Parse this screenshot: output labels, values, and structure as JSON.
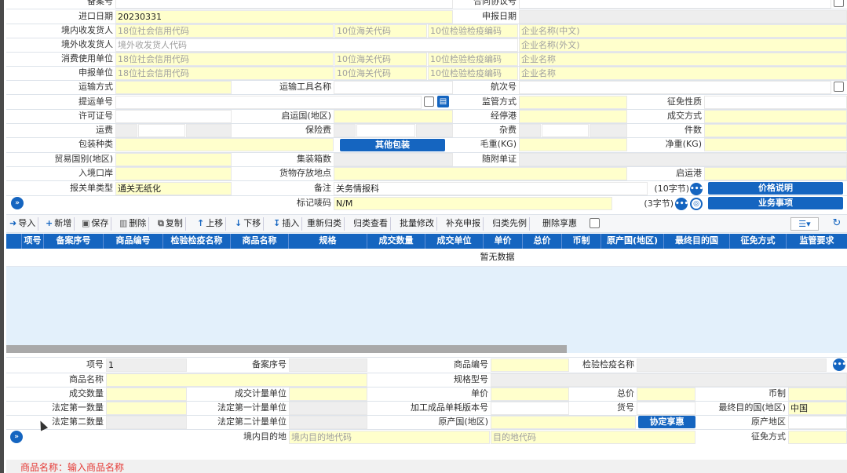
{
  "form": {
    "record_no_label": "备案号",
    "contract_no_label": "合同协议号",
    "import_date_label": "进口日期",
    "import_date": "20230331",
    "declare_date_label": "申报日期",
    "domestic_consignee_label": "境内收发货人",
    "credit_code_ph": "18位社会信用代码",
    "customs_code_ph": "10位海关代码",
    "ciq_code_ph": "10位检验检疫编码",
    "company_cn_ph": "企业名称(中文)",
    "overseas_consignee_label": "境外收发货人",
    "overseas_code_ph": "境外收发货人代码",
    "company_foreign_ph": "企业名称(外文)",
    "consumer_unit_label": "消费使用单位",
    "company_name_ph": "企业名称",
    "declarant_label": "申报单位",
    "transport_mode_label": "运输方式",
    "transport_tool_label": "运输工具名称",
    "voyage_label": "航次号",
    "bill_no_label": "提运单号",
    "supervision_label": "监管方式",
    "exemption_nature_label": "征免性质",
    "license_label": "许可证号",
    "departure_country_label": "启运国(地区)",
    "transit_port_label": "经停港",
    "deal_mode_label": "成交方式",
    "freight_label": "运费",
    "insurance_label": "保险费",
    "misc_fee_label": "杂费",
    "pieces_label": "件数",
    "package_label": "包装种类",
    "other_package_btn": "其他包装",
    "gross_weight_label": "毛重(KG)",
    "net_weight_label": "净重(KG)",
    "trade_country_label": "贸易国别(地区)",
    "container_count_label": "集装箱数",
    "attached_docs_label": "随附单证",
    "entry_port_label": "入境口岸",
    "goods_location_label": "货物存放地点",
    "departure_port_label": "启运港",
    "declaration_type_label": "报关单类型",
    "declaration_type": "通关无纸化",
    "remark_label": "备注",
    "remark": "关务情报科",
    "remark_hint": "(10字节)",
    "price_note_btn": "价格说明",
    "mark_label": "标记唛码",
    "mark": "N/M",
    "mark_hint": "(3字节)",
    "business_btn": "业务事项"
  },
  "toolbar": [
    "导入",
    "新增",
    "保存",
    "删除",
    "复制",
    "上移",
    "下移",
    "插入",
    "重新归类",
    "归类查看",
    "批量修改",
    "补充申报",
    "归类先例",
    "删除享惠"
  ],
  "table": {
    "headers": [
      "项号",
      "备案序号",
      "商品编号",
      "检验检疫名称",
      "商品名称",
      "规格",
      "成交数量",
      "成交单位",
      "单价",
      "总价",
      "币制",
      "原产国(地区)",
      "最终目的国",
      "征免方式",
      "监管要求"
    ],
    "empty": "暂无数据"
  },
  "detail": {
    "item_no_label": "项号",
    "item_no": "1",
    "record_seq_label": "备案序号",
    "goods_code_label": "商品编号",
    "ciq_name_label": "检验检疫名称",
    "goods_name_label": "商品名称",
    "spec_label": "规格型号",
    "deal_qty_label": "成交数量",
    "deal_unit_label": "成交计量单位",
    "unit_price_label": "单价",
    "total_price_label": "总价",
    "currency_label": "币制",
    "legal_qty1_label": "法定第一数量",
    "legal_unit1_label": "法定第一计量单位",
    "bom_version_label": "加工成品单耗版本号",
    "item_code_label": "货号",
    "final_country_label": "最终目的国(地区)",
    "final_country": "中国",
    "legal_qty2_label": "法定第二数量",
    "legal_unit2_label": "法定第二计量单位",
    "origin_country_label": "原产国(地区)",
    "agreement_btn": "协定享惠",
    "origin_region_label": "原产地区",
    "domestic_dest_label": "境内目的地",
    "domestic_dest_ph": "境内目的地代码",
    "dest_code_ph": "目的地代码",
    "exemption_mode_label": "征免方式"
  },
  "hint": "商品名称：输入商品名称"
}
